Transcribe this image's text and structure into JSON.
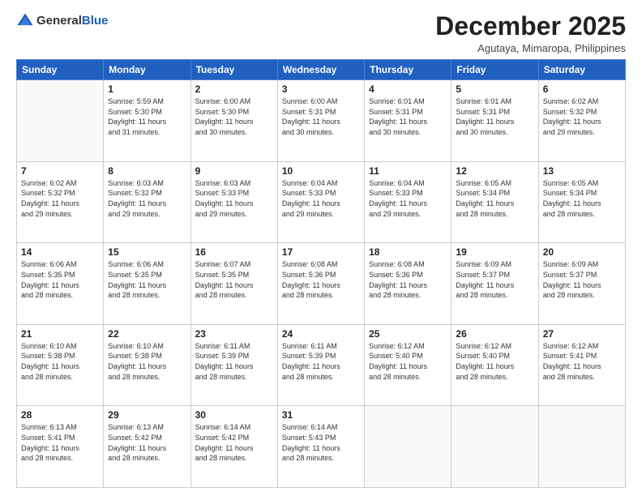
{
  "header": {
    "logo_general": "General",
    "logo_blue": "Blue",
    "title": "December 2025",
    "subtitle": "Agutaya, Mimaropa, Philippines"
  },
  "days_of_week": [
    "Sunday",
    "Monday",
    "Tuesday",
    "Wednesday",
    "Thursday",
    "Friday",
    "Saturday"
  ],
  "weeks": [
    [
      {
        "day": "",
        "info": ""
      },
      {
        "day": "1",
        "info": "Sunrise: 5:59 AM\nSunset: 5:30 PM\nDaylight: 11 hours\nand 31 minutes."
      },
      {
        "day": "2",
        "info": "Sunrise: 6:00 AM\nSunset: 5:30 PM\nDaylight: 11 hours\nand 30 minutes."
      },
      {
        "day": "3",
        "info": "Sunrise: 6:00 AM\nSunset: 5:31 PM\nDaylight: 11 hours\nand 30 minutes."
      },
      {
        "day": "4",
        "info": "Sunrise: 6:01 AM\nSunset: 5:31 PM\nDaylight: 11 hours\nand 30 minutes."
      },
      {
        "day": "5",
        "info": "Sunrise: 6:01 AM\nSunset: 5:31 PM\nDaylight: 11 hours\nand 30 minutes."
      },
      {
        "day": "6",
        "info": "Sunrise: 6:02 AM\nSunset: 5:32 PM\nDaylight: 11 hours\nand 29 minutes."
      }
    ],
    [
      {
        "day": "7",
        "info": "Sunrise: 6:02 AM\nSunset: 5:32 PM\nDaylight: 11 hours\nand 29 minutes."
      },
      {
        "day": "8",
        "info": "Sunrise: 6:03 AM\nSunset: 5:32 PM\nDaylight: 11 hours\nand 29 minutes."
      },
      {
        "day": "9",
        "info": "Sunrise: 6:03 AM\nSunset: 5:33 PM\nDaylight: 11 hours\nand 29 minutes."
      },
      {
        "day": "10",
        "info": "Sunrise: 6:04 AM\nSunset: 5:33 PM\nDaylight: 11 hours\nand 29 minutes."
      },
      {
        "day": "11",
        "info": "Sunrise: 6:04 AM\nSunset: 5:33 PM\nDaylight: 11 hours\nand 29 minutes."
      },
      {
        "day": "12",
        "info": "Sunrise: 6:05 AM\nSunset: 5:34 PM\nDaylight: 11 hours\nand 28 minutes."
      },
      {
        "day": "13",
        "info": "Sunrise: 6:05 AM\nSunset: 5:34 PM\nDaylight: 11 hours\nand 28 minutes."
      }
    ],
    [
      {
        "day": "14",
        "info": "Sunrise: 6:06 AM\nSunset: 5:35 PM\nDaylight: 11 hours\nand 28 minutes."
      },
      {
        "day": "15",
        "info": "Sunrise: 6:06 AM\nSunset: 5:35 PM\nDaylight: 11 hours\nand 28 minutes."
      },
      {
        "day": "16",
        "info": "Sunrise: 6:07 AM\nSunset: 5:35 PM\nDaylight: 11 hours\nand 28 minutes."
      },
      {
        "day": "17",
        "info": "Sunrise: 6:08 AM\nSunset: 5:36 PM\nDaylight: 11 hours\nand 28 minutes."
      },
      {
        "day": "18",
        "info": "Sunrise: 6:08 AM\nSunset: 5:36 PM\nDaylight: 11 hours\nand 28 minutes."
      },
      {
        "day": "19",
        "info": "Sunrise: 6:09 AM\nSunset: 5:37 PM\nDaylight: 11 hours\nand 28 minutes."
      },
      {
        "day": "20",
        "info": "Sunrise: 6:09 AM\nSunset: 5:37 PM\nDaylight: 11 hours\nand 28 minutes."
      }
    ],
    [
      {
        "day": "21",
        "info": "Sunrise: 6:10 AM\nSunset: 5:38 PM\nDaylight: 11 hours\nand 28 minutes."
      },
      {
        "day": "22",
        "info": "Sunrise: 6:10 AM\nSunset: 5:38 PM\nDaylight: 11 hours\nand 28 minutes."
      },
      {
        "day": "23",
        "info": "Sunrise: 6:11 AM\nSunset: 5:39 PM\nDaylight: 11 hours\nand 28 minutes."
      },
      {
        "day": "24",
        "info": "Sunrise: 6:11 AM\nSunset: 5:39 PM\nDaylight: 11 hours\nand 28 minutes."
      },
      {
        "day": "25",
        "info": "Sunrise: 6:12 AM\nSunset: 5:40 PM\nDaylight: 11 hours\nand 28 minutes."
      },
      {
        "day": "26",
        "info": "Sunrise: 6:12 AM\nSunset: 5:40 PM\nDaylight: 11 hours\nand 28 minutes."
      },
      {
        "day": "27",
        "info": "Sunrise: 6:12 AM\nSunset: 5:41 PM\nDaylight: 11 hours\nand 28 minutes."
      }
    ],
    [
      {
        "day": "28",
        "info": "Sunrise: 6:13 AM\nSunset: 5:41 PM\nDaylight: 11 hours\nand 28 minutes."
      },
      {
        "day": "29",
        "info": "Sunrise: 6:13 AM\nSunset: 5:42 PM\nDaylight: 11 hours\nand 28 minutes."
      },
      {
        "day": "30",
        "info": "Sunrise: 6:14 AM\nSunset: 5:42 PM\nDaylight: 11 hours\nand 28 minutes."
      },
      {
        "day": "31",
        "info": "Sunrise: 6:14 AM\nSunset: 5:43 PM\nDaylight: 11 hours\nand 28 minutes."
      },
      {
        "day": "",
        "info": ""
      },
      {
        "day": "",
        "info": ""
      },
      {
        "day": "",
        "info": ""
      }
    ]
  ]
}
